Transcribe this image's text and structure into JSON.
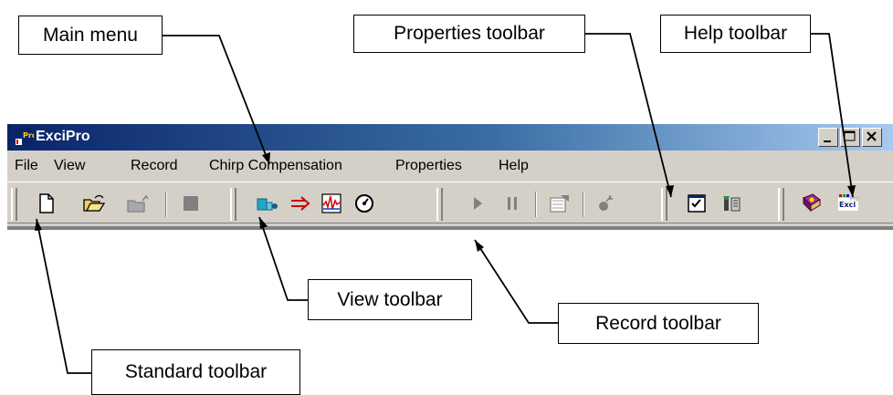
{
  "window": {
    "title": "ExciPro",
    "icon": "excipro-app-icon"
  },
  "menu": [
    "File",
    "View",
    "Record",
    "Chirp Compensation",
    "Properties",
    "Help"
  ],
  "toolbars": {
    "standard": [
      "new-file-icon",
      "open-folder-icon",
      "open-disabled-icon",
      "stop-disabled-icon"
    ],
    "view": [
      "view-data-icon",
      "arrow-icon",
      "spectrum-icon",
      "gauge-icon"
    ],
    "record": [
      "play-icon",
      "pause-icon",
      "chart-disabled-icon",
      "probe-disabled-icon"
    ],
    "properties": [
      "checklist-icon",
      "tools-icon"
    ],
    "help": [
      "help-book-icon",
      "about-excipro-icon"
    ]
  },
  "callouts": {
    "main_menu": "Main menu",
    "properties_toolbar": "Properties toolbar",
    "help_toolbar": "Help toolbar",
    "view_toolbar": "View toolbar",
    "record_toolbar": "Record toolbar",
    "standard_toolbar": "Standard toolbar"
  },
  "colors": {
    "titlebar_start": "#0a246a",
    "titlebar_end": "#a6caf0",
    "chrome": "#d4d0c8"
  }
}
